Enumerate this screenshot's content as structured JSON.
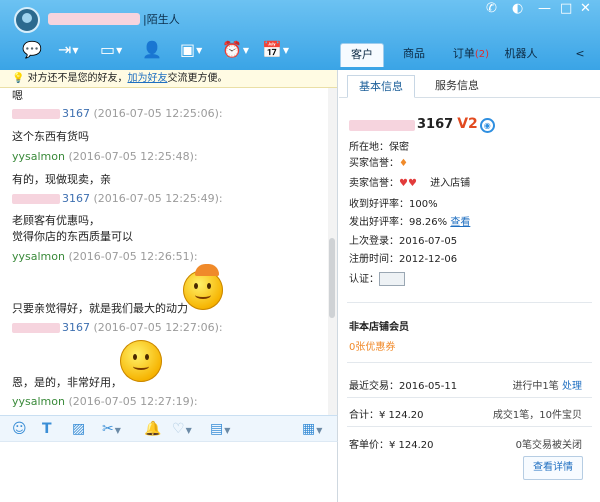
{
  "header": {
    "title_tag": "|陌生人",
    "tabs": [
      {
        "label": "客户",
        "badge": ""
      },
      {
        "label": "商品",
        "badge": ""
      },
      {
        "label": "订单",
        "badge": "(2)"
      },
      {
        "label": "机器人",
        "badge": ""
      }
    ],
    "window_controls": [
      "phone-icon",
      "skin-icon",
      "minimize-icon",
      "maximize-icon",
      "close-icon"
    ],
    "toolbar_icons": [
      "chat-icon",
      "transfer-icon",
      "video-icon",
      "add-contact-icon",
      "share-screen-icon",
      "alarm-icon",
      "calendar-icon"
    ],
    "more_arrow": "<"
  },
  "chat": {
    "notice": {
      "prefix": "对方还不是您的好友，",
      "link": "加为好友",
      "suffix": "交流更方便。"
    },
    "lines": [
      {
        "text": "嗯"
      },
      {
        "id_suffix": "3167",
        "time": "(2016-07-05 12:25:06):"
      },
      {
        "text": "这个东西有货吗"
      },
      {
        "name": "yysalmon",
        "time": "(2016-07-05 12:25:48):"
      },
      {
        "text": "有的，现做现卖，亲"
      },
      {
        "id_suffix": "3167",
        "time": "(2016-07-05 12:25:49):"
      },
      {
        "text": "老顾客有优惠吗，"
      },
      {
        "text": "觉得你店的东西质量可以"
      },
      {
        "name": "yysalmon",
        "time": "(2016-07-05 12:26:51):"
      },
      {
        "text": "只要亲觉得好，就是我们最大的动力"
      },
      {
        "id_suffix": "3167",
        "time": "(2016-07-05 12:27:06):"
      },
      {
        "text": "恩，是的，非常好用，"
      },
      {
        "name": "yysalmon",
        "time": "(2016-07-05 12:27:19):"
      }
    ]
  },
  "format_toolbar": [
    "smiley-icon",
    "font-icon",
    "image-icon",
    "scissors-icon",
    "bell-icon",
    "heart-icon",
    "coupon-icon",
    "more-icon"
  ],
  "side": {
    "tabs": [
      "基本信息",
      "服务信息"
    ],
    "user_suffix": "3167",
    "vip": "V2",
    "location": "所在地：保密",
    "buyer_credit": "买家信誉：",
    "seller_credit": "卖家信誉：",
    "enter_shop": "进入店铺",
    "positive_received": "收到好评率：100%",
    "positive_given_prefix": "发出好评率：98.26%",
    "view_link": "查看",
    "last_login": "上次登录：2016-07-05",
    "register_time": "注册时间：2012-12-06",
    "auth": "认证：",
    "member_title": "非本店铺会员",
    "coupon": "0张优惠券",
    "recent_trade": "最近交易：2016-05-11",
    "in_progress": "进行中1笔",
    "handle_link": "处理",
    "total": "合计：¥ 124.20",
    "deals": "成交1笔，10件宝贝",
    "unit_price": "客单价：¥ 124.20",
    "closed": "0笔交易被关闭",
    "detail_button": "查看详情"
  }
}
